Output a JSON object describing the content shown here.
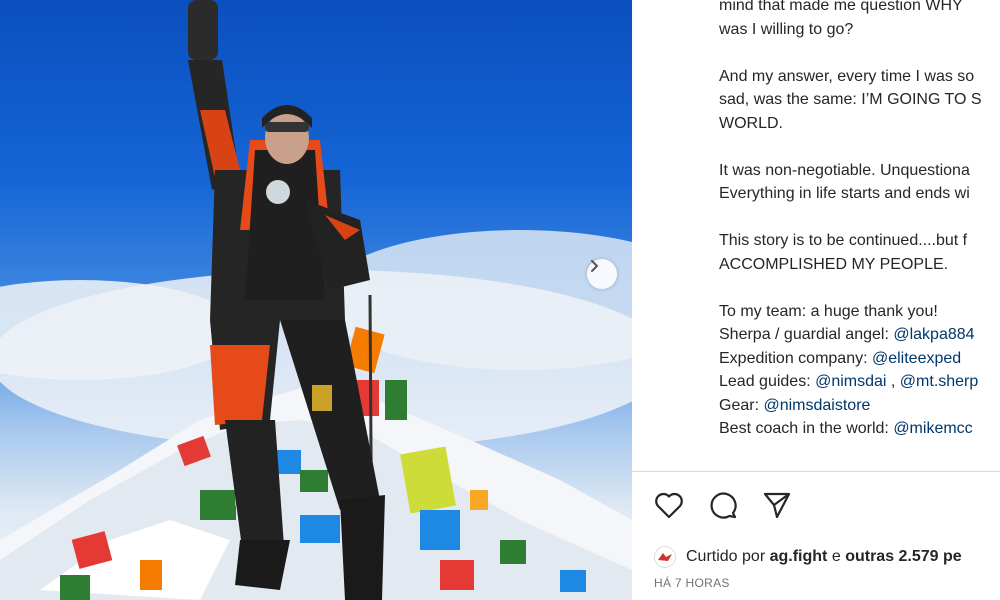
{
  "post": {
    "image_alt": "Climber celebrating at a snowy summit with prayer flags",
    "next_label": "›"
  },
  "caption": {
    "lines": [
      {
        "text": "mind that made me question WHY"
      },
      {
        "text": "was I willing to go?"
      },
      {
        "text": ""
      },
      {
        "text": "And my answer, every time I was so"
      },
      {
        "text": "sad, was the same: I’M GOING TO S"
      },
      {
        "text": "WORLD."
      },
      {
        "text": ""
      },
      {
        "text": "It was non-negotiable. Unquestiona"
      },
      {
        "text": "Everything in life starts and ends wi"
      },
      {
        "text": ""
      },
      {
        "text": "This story is to be continued....but f"
      },
      {
        "text": "ACCOMPLISHED MY PEOPLE."
      },
      {
        "text": ""
      },
      {
        "text": "To my team: a huge thank you!"
      }
    ],
    "credits": [
      {
        "label": "Sherpa / guardial angel: ",
        "mention": "@lakpa884"
      },
      {
        "label": "Expedition company: ",
        "mention": "@eliteexped"
      },
      {
        "label": "Lead guides: ",
        "mention": "@nimsdai",
        "sep": " , ",
        "mention2": "@mt.sherp"
      },
      {
        "label": "Gear: ",
        "mention": "@nimsdaistore"
      },
      {
        "label": "Best coach in the world: ",
        "mention": "@mikemcc"
      }
    ]
  },
  "actions": {
    "like": "heart-icon",
    "comment": "comment-icon",
    "share": "share-icon"
  },
  "likes": {
    "prefix": "Curtido por",
    "user": "ag.fight",
    "middle": "e",
    "others": "outras 2.579 pe"
  },
  "timestamp": "HÁ 7 HORAS",
  "colors": {
    "mention": "#00376b",
    "text": "#262626",
    "muted": "#737373"
  }
}
